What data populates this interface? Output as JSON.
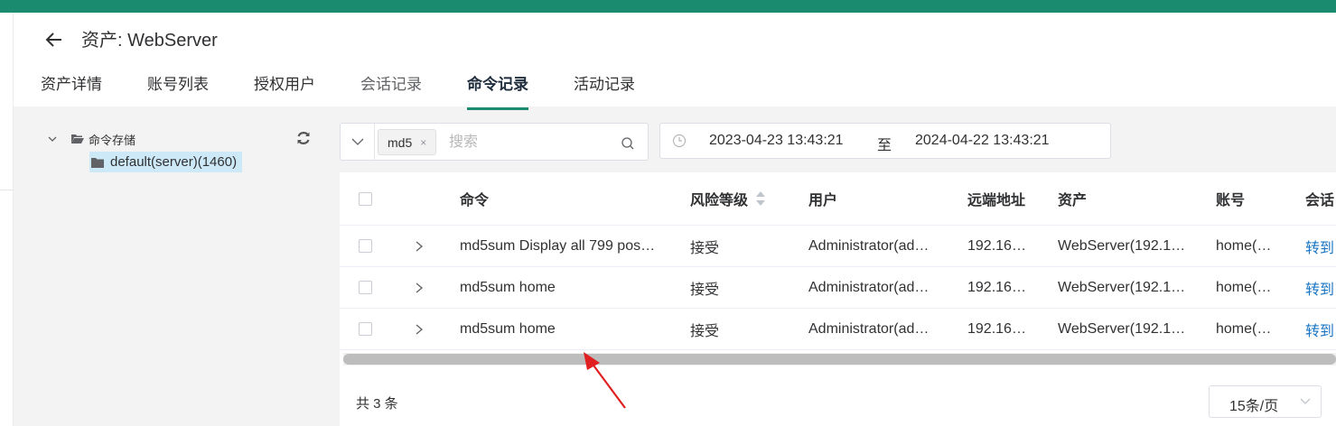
{
  "header": {
    "title": "资产: WebServer",
    "tabs": [
      {
        "label": "资产详情"
      },
      {
        "label": "账号列表"
      },
      {
        "label": "授权用户"
      },
      {
        "label": "会话记录"
      },
      {
        "label": "命令记录",
        "active": true
      },
      {
        "label": "活动记录"
      }
    ]
  },
  "tree": {
    "root_label": "命令存储",
    "child_label": "default(server)(1460)"
  },
  "search": {
    "tag": "md5",
    "tag_close": "×",
    "placeholder": "搜索"
  },
  "date_range": {
    "start": "2023-04-23 13:43:21",
    "separator": "至",
    "end": "2024-04-22 13:43:21"
  },
  "table": {
    "columns": {
      "command": "命令",
      "risk": "风险等级",
      "user": "用户",
      "remote_addr": "远端地址",
      "asset": "资产",
      "account": "账号",
      "session": "会话"
    },
    "rows": [
      {
        "command": "md5sum Display all 799 pos…",
        "risk": "接受",
        "user": "Administrator(ad…",
        "remote_addr": "192.16…",
        "asset": "WebServer(192.1…",
        "account": "home(…",
        "session": "转到"
      },
      {
        "command": "md5sum home",
        "risk": "接受",
        "user": "Administrator(ad…",
        "remote_addr": "192.16…",
        "asset": "WebServer(192.1…",
        "account": "home(…",
        "session": "转到"
      },
      {
        "command": "md5sum home",
        "risk": "接受",
        "user": "Administrator(ad…",
        "remote_addr": "192.16…",
        "asset": "WebServer(192.1…",
        "account": "home(…",
        "session": "转到"
      }
    ]
  },
  "pagination": {
    "total": "共 3 条",
    "page_size": "15条/页"
  },
  "colors": {
    "accent": "#1a8b6e",
    "link": "#1a75c2",
    "annotation_arrow": "#e02020"
  }
}
